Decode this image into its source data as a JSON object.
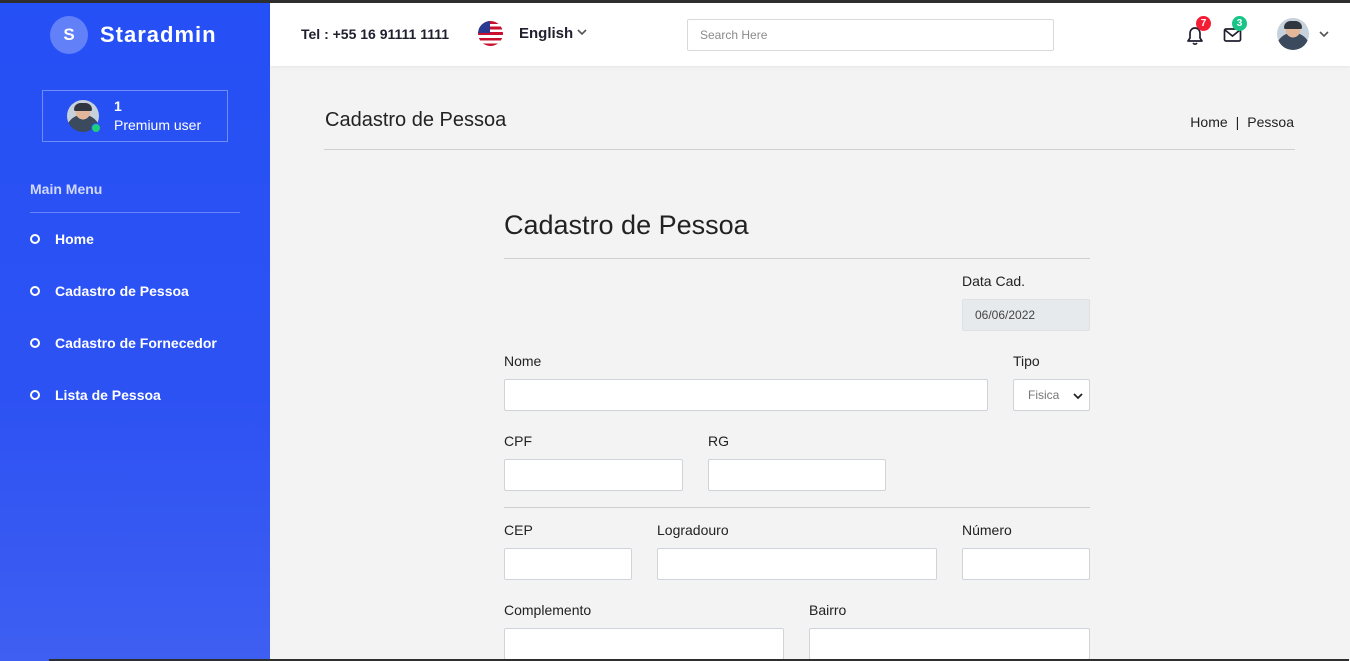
{
  "brand": {
    "logo_letter": "S",
    "name": "Staradmin"
  },
  "user": {
    "name": "1",
    "role": "Premium user",
    "status_color": "#1bcf7d"
  },
  "sidebar": {
    "menu_title": "Main Menu",
    "items": [
      {
        "label": "Home"
      },
      {
        "label": "Cadastro de Pessoa"
      },
      {
        "label": "Cadastro de Fornecedor"
      },
      {
        "label": "Lista de Pessoa"
      }
    ]
  },
  "header": {
    "phone": "Tel : +55 16 91111 1111",
    "language": "English",
    "flag_icon": "us-flag-icon",
    "search_placeholder": "Search Here",
    "notifications_count": "7",
    "messages_count": "3",
    "notification_badge_color": "#f51d34",
    "messages_badge_color": "#18c586"
  },
  "page": {
    "title": "Cadastro de Pessoa",
    "breadcrumb": [
      "Home",
      "Pessoa"
    ]
  },
  "form": {
    "title": "Cadastro de Pessoa",
    "data_cad": {
      "label": "Data Cad.",
      "value": "06/06/2022"
    },
    "nome": {
      "label": "Nome",
      "value": ""
    },
    "tipo": {
      "label": "Tipo",
      "value": "Fisica"
    },
    "cpf": {
      "label": "CPF",
      "value": ""
    },
    "rg": {
      "label": "RG",
      "value": ""
    },
    "cep": {
      "label": "CEP",
      "value": ""
    },
    "logradouro": {
      "label": "Logradouro",
      "value": ""
    },
    "numero": {
      "label": "Número",
      "value": ""
    },
    "complemento": {
      "label": "Complemento",
      "value": ""
    },
    "bairro": {
      "label": "Bairro",
      "value": ""
    }
  },
  "colors": {
    "sidebar": "#2550f5",
    "content_bg": "#f3f3f3"
  }
}
